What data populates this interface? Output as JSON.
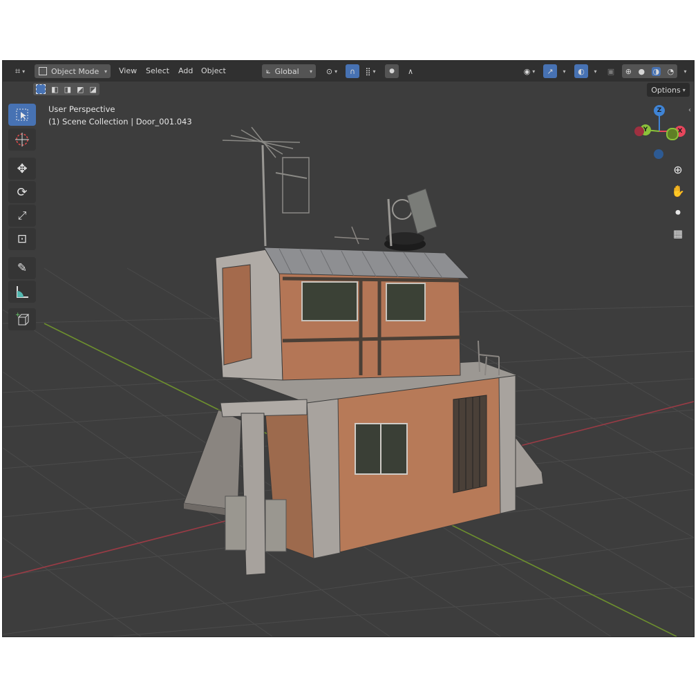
{
  "header": {
    "editor_type_icon": "editor-type-icon",
    "mode_label": "Object Mode",
    "menus": [
      "View",
      "Select",
      "Add",
      "Object"
    ],
    "transform_orientation": "Global",
    "options_label": "Options"
  },
  "overlay": {
    "perspective": "User Perspective",
    "collection_info": "(1) Scene Collection | Door_001.043"
  },
  "gizmo": {
    "z": "Z",
    "y": "Y",
    "x": "X"
  },
  "colors": {
    "accent": "#4772b3",
    "axis_x": "#e8465c",
    "axis_y": "#8bc23a",
    "axis_z": "#3f84d6",
    "viewport_bg": "#3d3d3d"
  },
  "toolbar": [
    "select-box-icon",
    "cursor-icon",
    "move-icon",
    "rotate-icon",
    "scale-icon",
    "transform-icon",
    "annotate-icon",
    "measure-icon",
    "add-cube-icon"
  ],
  "nav": [
    "zoom-icon",
    "pan-hand-icon",
    "camera-icon",
    "orthographic-grid-icon"
  ]
}
